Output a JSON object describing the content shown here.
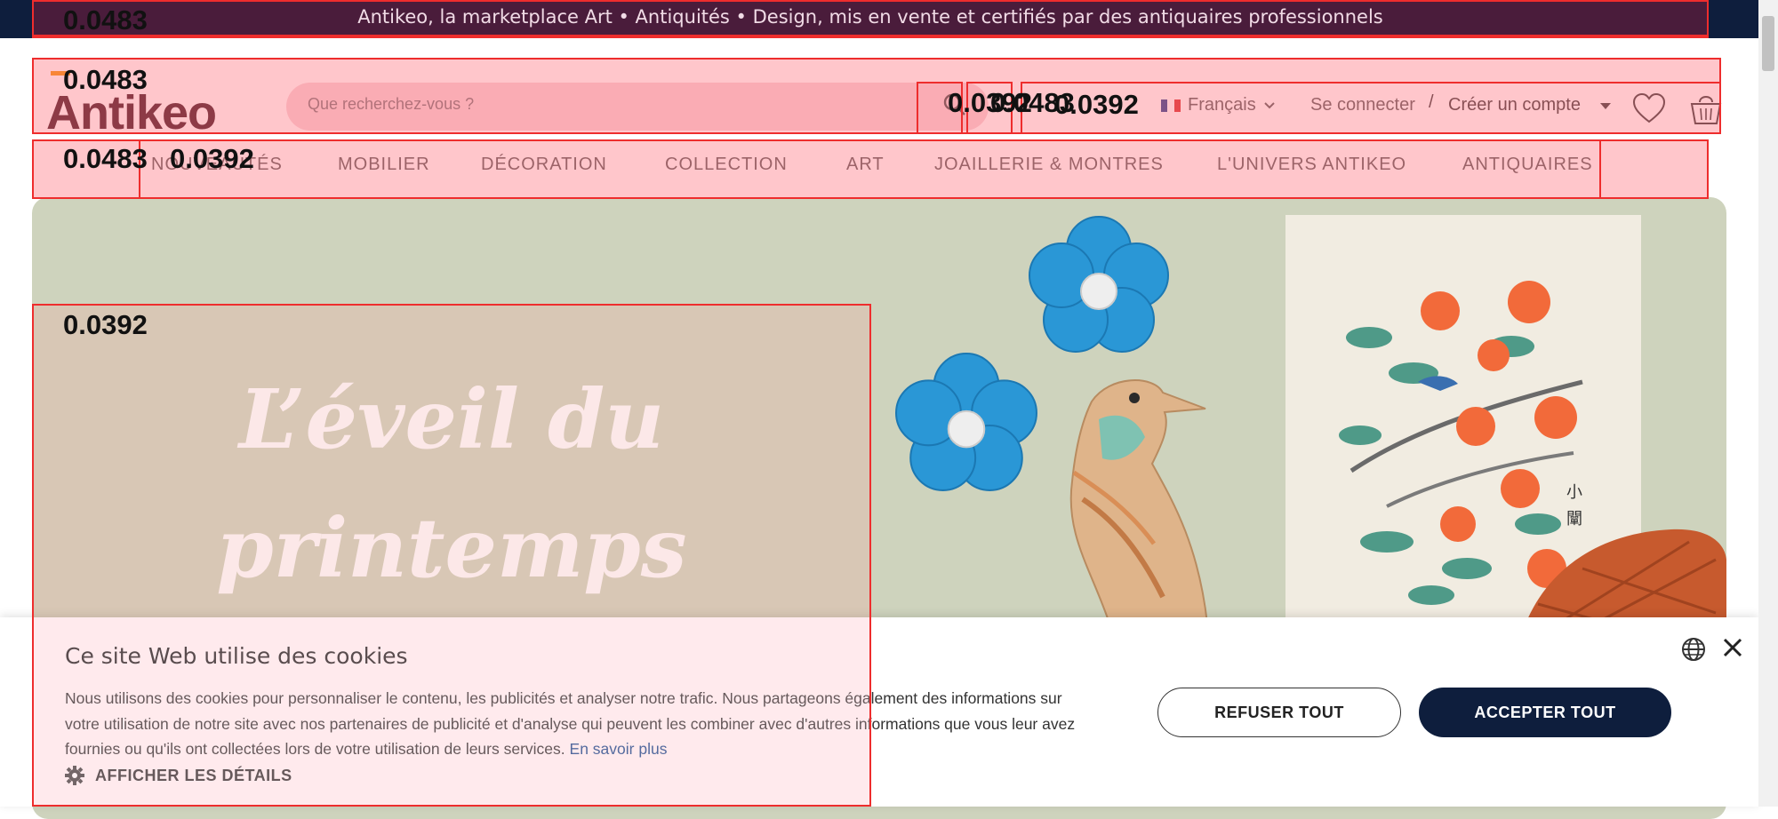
{
  "announcement": "Antikeo, la marketplace Art • Antiquités • Design, mis en vente et certifiés par des antiquaires professionnels",
  "header": {
    "logo": "Antikeo",
    "search_placeholder": "Que recherchez-vous ?",
    "language": "Français",
    "login": "Se connecter",
    "separator": "/",
    "signup": "Créer un compte"
  },
  "nav": {
    "items": [
      "NOUVEAUTÉS",
      "MOBILIER",
      "DÉCORATION",
      "COLLECTION",
      "ART",
      "JOAILLERIE & MONTRES",
      "L'UNIVERS ANTIKEO",
      "ANTIQUAIRES"
    ]
  },
  "hero": {
    "line1": "L’éveil du",
    "line2": "printemps"
  },
  "cookie": {
    "title": "Ce site Web utilise des cookies",
    "text": "Nous utilisons des cookies pour personnaliser le contenu, les publicités et analyser notre trafic. Nous partageons également des informations sur votre utilisation de notre site avec nos partenaires de publicité et d'analyse qui peuvent les combiner avec d'autres informations que vous leur avez fournies ou qu'ils ont collectées lors de votre utilisation de leurs services.",
    "learn_more": "En savoir plus",
    "details": "AFFICHER LES DÉTAILS",
    "refuse": "REFUSER TOUT",
    "accept": "ACCEPTER TOUT"
  },
  "overlay_scores": {
    "s1": "0.0483",
    "s2": "0.0483",
    "s3": "0.0483",
    "s4": "0.0392",
    "s5": "0.0392",
    "s6": "0.0392",
    "s7": "0.0483",
    "s8": "0.0392"
  },
  "colors": {
    "navy": "#0e1e3d",
    "maroon": "#3c0e1b",
    "hero_bg": "#ced3bd",
    "overlay_red": "#ee2d2d"
  }
}
